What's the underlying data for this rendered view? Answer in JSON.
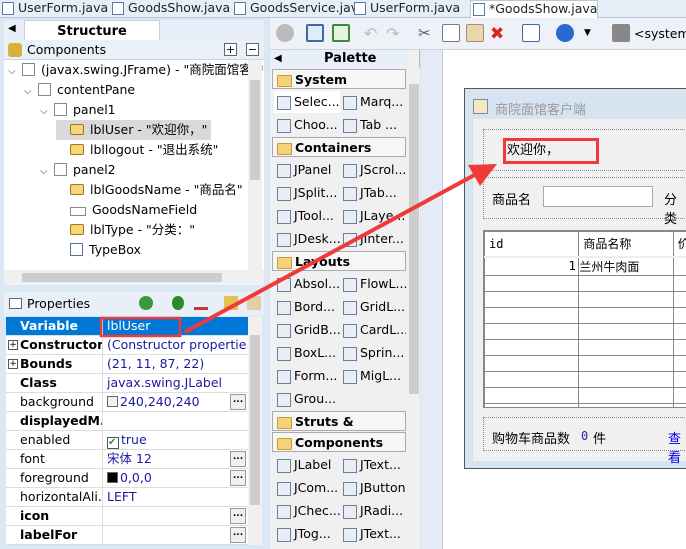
{
  "editor_tabs": [
    {
      "label": "UserForm.java"
    },
    {
      "label": "GoodsShow.java"
    },
    {
      "label": "GoodsService.java"
    },
    {
      "label": "UserForm.java"
    },
    {
      "label": "*GoodsShow.java",
      "active": true
    }
  ],
  "structure": {
    "title": "Structure",
    "components_label": "Components",
    "tree": [
      {
        "label": "(javax.swing.JFrame) - \"商院面馆客户端\"",
        "level": 0,
        "kind": "frame",
        "expanded": true
      },
      {
        "label": "contentPane",
        "level": 1,
        "kind": "panel",
        "expanded": true
      },
      {
        "label": "panel1",
        "level": 2,
        "kind": "panel",
        "expanded": true
      },
      {
        "label": "lblUser - \"欢迎你，\"",
        "level": 3,
        "kind": "label",
        "selected": true
      },
      {
        "label": "lbllogout - \"退出系统\"",
        "level": 3,
        "kind": "label"
      },
      {
        "label": "panel2",
        "level": 2,
        "kind": "panel",
        "expanded": true
      },
      {
        "label": "lblGoodsName - \"商品名\"",
        "level": 3,
        "kind": "label"
      },
      {
        "label": "GoodsNameField",
        "level": 3,
        "kind": "textfield"
      },
      {
        "label": "lblType - \"分类：\"",
        "level": 3,
        "kind": "label"
      },
      {
        "label": "TypeBox",
        "level": 3,
        "kind": "combobox"
      }
    ]
  },
  "properties": {
    "title": "Properties",
    "rows": [
      {
        "key": "Variable",
        "value": "lblUser",
        "bold": true,
        "selected": true
      },
      {
        "key": "Constructor",
        "value": "(Constructor propertie...",
        "bold": true,
        "expand": true
      },
      {
        "key": "Bounds",
        "value": "(21, 11, 87, 22)",
        "bold": true,
        "expand": true
      },
      {
        "key": "Class",
        "value": "javax.swing.JLabel",
        "bold": true
      },
      {
        "key": "background",
        "value": "240,240,240",
        "swatch": "#f0f0f0",
        "dots": true
      },
      {
        "key": "displayedM...",
        "value": "",
        "bold": true
      },
      {
        "key": "enabled",
        "value": "true",
        "check": true
      },
      {
        "key": "font",
        "value": "宋体 12",
        "dots": true
      },
      {
        "key": "foreground",
        "value": "0,0,0",
        "swatch": "#000000",
        "dots": true
      },
      {
        "key": "horizontalAli...",
        "value": "LEFT"
      },
      {
        "key": "icon",
        "value": "",
        "bold": true,
        "dots": true
      },
      {
        "key": "labelFor",
        "value": "",
        "bold": true,
        "dots": true
      }
    ]
  },
  "toolbar": {
    "system_label": "<system>"
  },
  "palette": {
    "title": "Palette",
    "sections": [
      {
        "name": "System",
        "items": [
          "Selec...",
          "Marq...",
          "Choo...",
          "Tab ..."
        ]
      },
      {
        "name": "Containers",
        "items": [
          "JPanel",
          "JScrol...",
          "JSplit...",
          "JTab...",
          "JTool...",
          "JLaye...",
          "JDesk...",
          "JInter..."
        ]
      },
      {
        "name": "Layouts",
        "items": [
          "Absol...",
          "FlowL...",
          "Bord...",
          "GridL...",
          "GridB...",
          "CardL...",
          "BoxL...",
          "Sprin...",
          "Form...",
          "MigL...",
          "Grou..."
        ]
      },
      {
        "name": "Struts & Springs",
        "items": []
      },
      {
        "name": "Components",
        "items": [
          "JLabel",
          "JText...",
          "JCom...",
          "JButton",
          "JChec...",
          "JRadi...",
          "JTog...",
          "JText..."
        ]
      }
    ]
  },
  "design": {
    "frame_title": "商院面馆客户端",
    "welcome": "欢迎你，",
    "goods_name_label": "商品名",
    "type_label": "分类",
    "table": {
      "columns": [
        "id",
        "商品名称",
        "价"
      ],
      "rows": [
        [
          "1",
          "兰州牛肉面",
          ""
        ]
      ]
    },
    "cart_label": "购物车商品数",
    "cart_count": "0",
    "cart_unit": "件",
    "view_link": "查看"
  },
  "colors": {
    "selection": "#0078d7",
    "highlight": "#ff3333",
    "link": "#0000ee"
  }
}
